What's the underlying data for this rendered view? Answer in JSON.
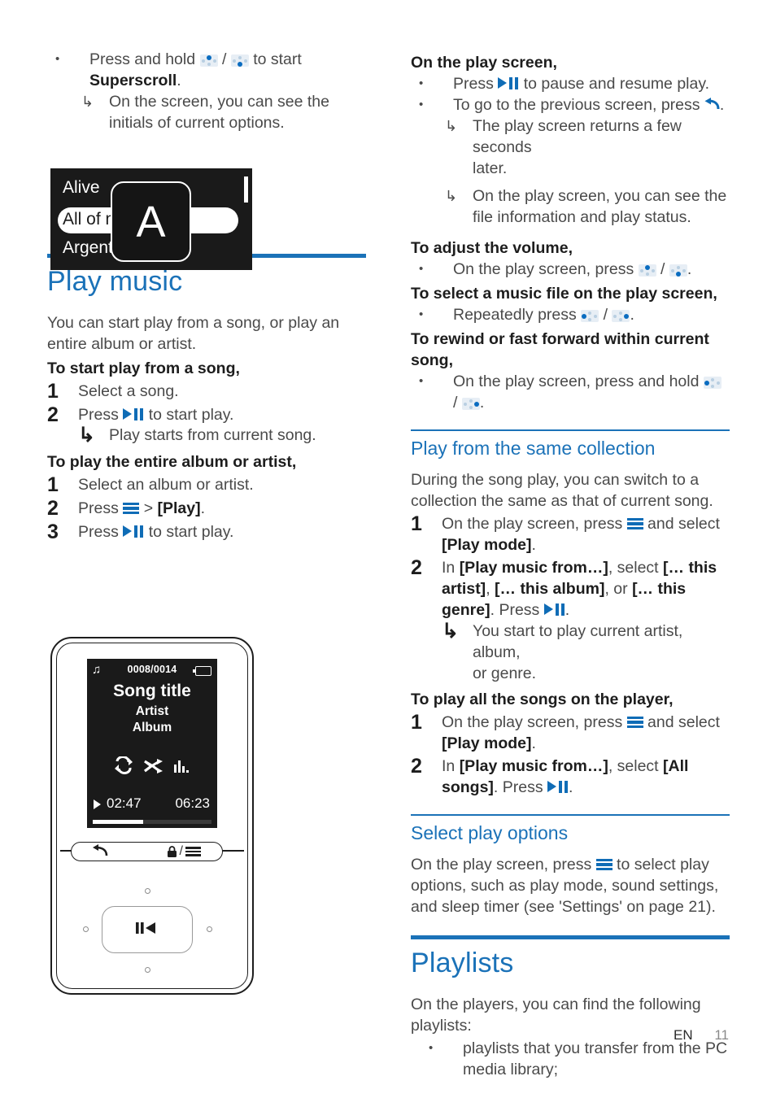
{
  "page": {
    "language_code": "EN",
    "page_number": "11",
    "accent_color": "#1b72b8",
    "body_color": "#4a4a4a"
  },
  "left_column": {
    "superscroll": {
      "bullet": {
        "text_before": "Press and hold",
        "sep": "/",
        "text_after": "to start",
        "bold_term": "Superscroll",
        "period": "."
      },
      "arrow": {
        "line1": "On the screen, you can see the",
        "line2": "initials of current options."
      },
      "figure": {
        "item_above": "Alive",
        "item_selected": "All of me",
        "item_below": "Argentina",
        "overlay_letter": "A"
      }
    },
    "play_music": {
      "heading": "Play music",
      "intro": "You can start play from a song, or play an entire album or artist.",
      "start_from_song": {
        "heading": "To start play from a song,",
        "step1_num": "1",
        "step1": "Select a song.",
        "step2_num": "2",
        "step2_before": "Press",
        "step2_after": "to start play.",
        "step2_arrow": "Play starts from current song."
      },
      "entire_album": {
        "heading": "To play the entire album or artist,",
        "step1_num": "1",
        "step1": "Select an album or artist.",
        "step2_num": "2",
        "step2_before": "Press",
        "step2_mid": ">",
        "step2_bold": "[Play]",
        "step2_end": ".",
        "step3_num": "3",
        "step3_before": "Press",
        "step3_after": "to start play."
      }
    },
    "player_figure": {
      "track_counter": "0008/0014",
      "song_title": "Song title",
      "artist": "Artist",
      "album": "Album",
      "time_elapsed": "02:47",
      "time_total": "06:23",
      "music_note_glyph": "♫"
    }
  },
  "right_column": {
    "on_play_screen": {
      "heading": "On the play screen,",
      "bullet1_before": "Press",
      "bullet1_after": "to pause and resume play.",
      "bullet2_before": "To go to the previous screen, press",
      "bullet2_after": ".",
      "arrow1_line1": "The play screen returns a few seconds",
      "arrow1_line2": "later.",
      "arrow2_line1": "On the play screen, you can see the",
      "arrow2_line2": "file information and play status."
    },
    "adjust_volume": {
      "heading": "To adjust the volume,",
      "bullet_before": "On the play screen, press",
      "sep": "/",
      "bullet_after": "."
    },
    "select_music_file": {
      "heading": "To select a music file on the play screen,",
      "bullet_before": "Repeatedly press",
      "sep": "/",
      "bullet_after": "."
    },
    "rewind_fast_forward": {
      "heading": "To rewind or fast forward within current song,",
      "bullet_before": "On the play screen, press and hold",
      "sep": "/",
      "bullet_after": "."
    },
    "play_same_collection": {
      "heading": "Play from the same collection",
      "intro": "During the song play, you can switch to a collection the same as that of current song.",
      "step1_num": "1",
      "step1_before": "On the play screen, press",
      "step1_mid": "and select",
      "step1_bold": "[Play mode]",
      "step1_end": ".",
      "step2_num": "2",
      "step2_t1": "In",
      "step2_b1": "[Play music from…]",
      "step2_t2": ", select",
      "step2_b2": "[… this artist]",
      "step2_t3": ",",
      "step2_b3": "[… this album]",
      "step2_t4": ", or",
      "step2_b4": "[… this genre]",
      "step2_t5": ".",
      "step2_press": "Press",
      "step2_end": ".",
      "step2_arrow_l1": "You start to play current artist, album,",
      "step2_arrow_l2": "or genre."
    },
    "play_all_songs": {
      "heading": "To play all the songs on the player,",
      "step1_num": "1",
      "step1_before": "On the play screen, press",
      "step1_mid": "and select",
      "step1_bold": "[Play mode]",
      "step1_end": ".",
      "step2_num": "2",
      "step2_t1": "In",
      "step2_b1": "[Play music from…]",
      "step2_t2": ", select",
      "step2_b2": "[All songs]",
      "step2_t3": ".",
      "step2_press": "Press",
      "step2_end": "."
    },
    "select_play_options": {
      "heading": "Select play options",
      "text_before": "On the play screen, press",
      "text_after": "to select play options, such as play mode, sound settings, and sleep timer (see 'Settings' on page 21)."
    },
    "playlists": {
      "heading": "Playlists",
      "intro": "On the players, you can find the following playlists:",
      "bullet1_l1": "playlists that you transfer from the PC",
      "bullet1_l2": "media library;"
    }
  }
}
